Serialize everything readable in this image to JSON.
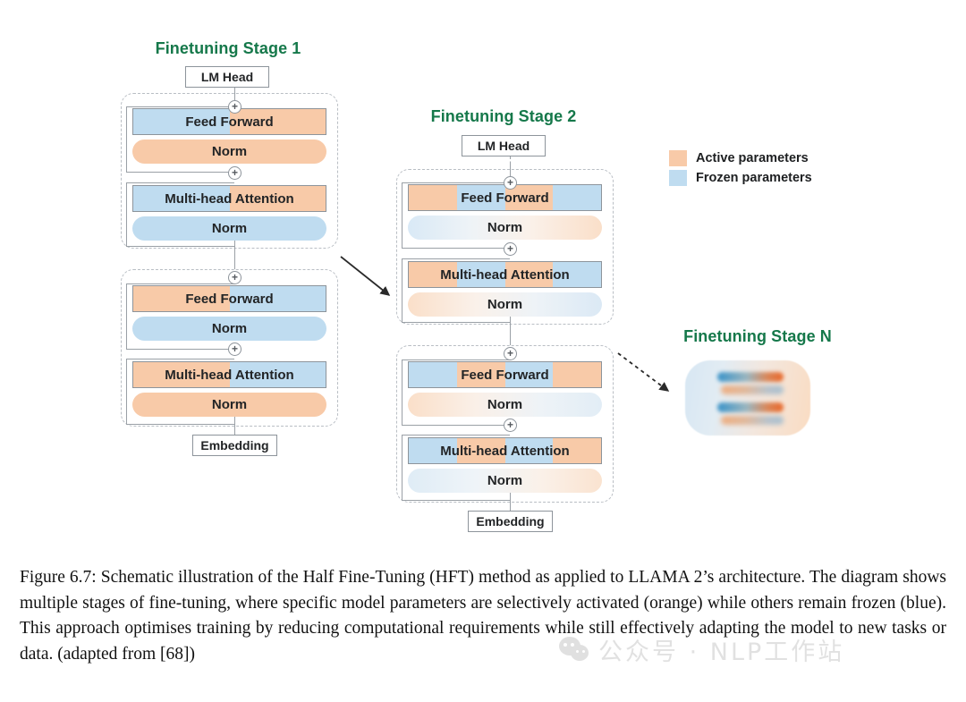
{
  "colors": {
    "active": "#f8caa8",
    "frozen": "#bfdcf0",
    "title_green": "#15784a",
    "line": "#9aa0a6",
    "dashed_border": "#b9bec4",
    "text": "#222426",
    "stageN_blue": "#2e90c8",
    "stageN_orange": "#e9682a"
  },
  "legend": {
    "items": [
      {
        "label": "Active parameters",
        "color": "#f8caa8",
        "swatch_name": "active-parameters-swatch"
      },
      {
        "label": "Frozen parameters",
        "color": "#bfdcf0",
        "swatch_name": "frozen-parameters-swatch"
      }
    ]
  },
  "stages": [
    {
      "id": "stage1",
      "title": "Finetuning Stage 1",
      "top_box": "LM Head",
      "bottom_box": "Embedding",
      "blocks": [
        {
          "name": "stage1-block-upper",
          "layers": [
            {
              "label": "Feed Forward",
              "shape": "rect",
              "segments": [
                "frozen",
                "active"
              ]
            },
            {
              "label": "Norm",
              "shape": "round",
              "segments": [
                "active"
              ]
            }
          ]
        },
        {
          "name": "stage1-block-upper-attention",
          "layers": [
            {
              "label": "Multi-head Attention",
              "shape": "rect",
              "segments": [
                "frozen",
                "active"
              ]
            },
            {
              "label": "Norm",
              "shape": "round",
              "segments": [
                "frozen"
              ]
            }
          ]
        },
        {
          "name": "stage1-block-lower",
          "layers": [
            {
              "label": "Feed Forward",
              "shape": "rect",
              "segments": [
                "active",
                "frozen"
              ]
            },
            {
              "label": "Norm",
              "shape": "round",
              "segments": [
                "frozen"
              ]
            }
          ]
        },
        {
          "name": "stage1-block-lower-attention",
          "layers": [
            {
              "label": "Multi-head Attention",
              "shape": "rect",
              "segments": [
                "active",
                "frozen"
              ]
            },
            {
              "label": "Norm",
              "shape": "round",
              "segments": [
                "active"
              ]
            }
          ]
        }
      ]
    },
    {
      "id": "stage2",
      "title": "Finetuning Stage 2",
      "top_box": "LM Head",
      "bottom_box": "Embedding",
      "blocks": [
        {
          "name": "stage2-block-upper",
          "layers": [
            {
              "label": "Feed Forward",
              "shape": "rect",
              "segments": [
                "active",
                "frozen",
                "active",
                "frozen"
              ]
            },
            {
              "label": "Norm",
              "shape": "round",
              "segments": [
                "gradient-blue-orange"
              ]
            }
          ]
        },
        {
          "name": "stage2-block-upper-attention",
          "layers": [
            {
              "label": "Multi-head Attention",
              "shape": "rect",
              "segments": [
                "active",
                "frozen",
                "active",
                "frozen"
              ]
            },
            {
              "label": "Norm",
              "shape": "round",
              "segments": [
                "gradient-orange-blue"
              ]
            }
          ]
        },
        {
          "name": "stage2-block-lower",
          "layers": [
            {
              "label": "Feed Forward",
              "shape": "rect",
              "segments": [
                "frozen",
                "active",
                "frozen",
                "active"
              ]
            },
            {
              "label": "Norm",
              "shape": "round",
              "segments": [
                "gradient-orange-blue"
              ]
            }
          ]
        },
        {
          "name": "stage2-block-lower-attention",
          "layers": [
            {
              "label": "Multi-head Attention",
              "shape": "rect",
              "segments": [
                "frozen",
                "active",
                "frozen",
                "active"
              ]
            },
            {
              "label": "Norm",
              "shape": "round",
              "segments": [
                "gradient-blue-orange"
              ]
            }
          ]
        }
      ]
    },
    {
      "id": "stageN",
      "title": "Finetuning Stage N",
      "card": {
        "bars": [
          {
            "name": "stageN-bar-1",
            "shape": "rect",
            "gradient": "blue-orange"
          },
          {
            "name": "stageN-bar-2",
            "shape": "round",
            "gradient": "orange-blue"
          },
          {
            "name": "stageN-bar-3",
            "shape": "rect",
            "gradient": "blue-orange"
          },
          {
            "name": "stageN-bar-4",
            "shape": "round",
            "gradient": "orange-blue"
          }
        ]
      }
    }
  ],
  "plus_symbol": "+",
  "caption": {
    "text": "Figure 6.7: Schematic illustration of the Half Fine-Tuning (HFT) method as applied to LLAMA 2’s architecture. The diagram shows multiple stages of fine-tuning, where specific model parameters are selectively activated (orange) while others remain frozen (blue). This approach optimises training by reducing computational requirements while still effectively adapting the model to new tasks or data. (adapted from [68])"
  },
  "watermark": {
    "text": "公众号 · NLP工作站"
  }
}
